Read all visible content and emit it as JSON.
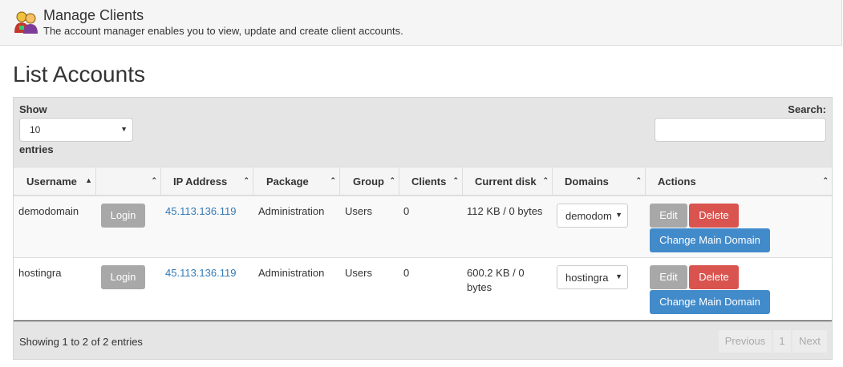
{
  "header": {
    "title": "Manage Clients",
    "subtitle": "The account manager enables you to view, update and create client accounts."
  },
  "list_title": "List Accounts",
  "controls": {
    "show_label": "Show",
    "page_length": "10",
    "entries_label": "entries",
    "search_label": "Search:",
    "search_value": ""
  },
  "columns": [
    "Username",
    "",
    "IP Address",
    "Package",
    "Group",
    "Clients",
    "Current disk",
    "Domains",
    "Actions"
  ],
  "rows": [
    {
      "username": "demodomain",
      "login": "Login",
      "ip": "45.113.136.119",
      "package": "Administration",
      "group": "Users",
      "clients": "0",
      "disk_line1": "112 KB / 0 bytes",
      "disk_line2": "",
      "domain": "demodomain",
      "edit": "Edit",
      "delete": "Delete",
      "change": "Change Main Domain"
    },
    {
      "username": "hostingra",
      "login": "Login",
      "ip": "45.113.136.119",
      "package": "Administration",
      "group": "Users",
      "clients": "0",
      "disk_line1": "600.2 KB / 0",
      "disk_line2": "bytes",
      "domain": "hostingra",
      "edit": "Edit",
      "delete": "Delete",
      "change": "Change Main Domain"
    }
  ],
  "footer": {
    "info": "Showing 1 to 2 of 2 entries",
    "previous": "Previous",
    "page": "1",
    "next": "Next"
  }
}
